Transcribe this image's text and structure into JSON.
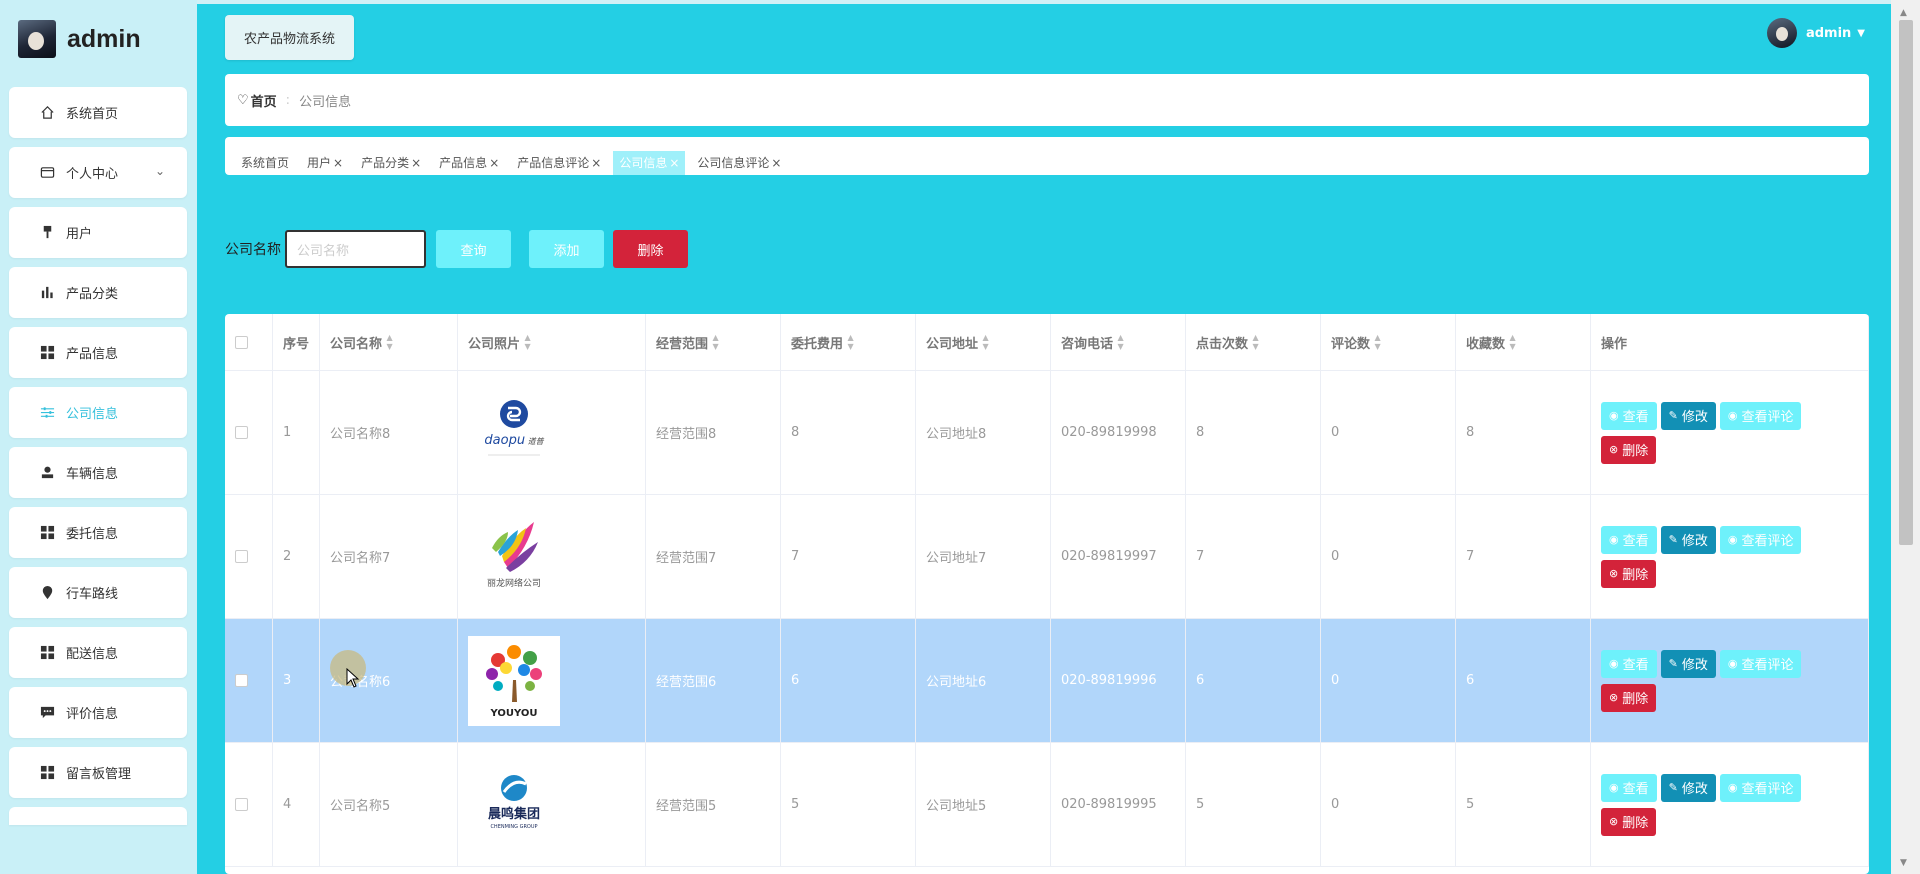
{
  "sidebar": {
    "brand": "admin",
    "items": [
      {
        "label": "系统首页",
        "icon": "home-icon"
      },
      {
        "label": "个人中心",
        "icon": "wallet-icon",
        "expandable": true
      },
      {
        "label": "用户",
        "icon": "user-pin-icon"
      },
      {
        "label": "产品分类",
        "icon": "bar-chart-icon"
      },
      {
        "label": "产品信息",
        "icon": "grid-icon"
      },
      {
        "label": "公司信息",
        "icon": "sliders-icon",
        "active": true
      },
      {
        "label": "车辆信息",
        "icon": "person-icon"
      },
      {
        "label": "委托信息",
        "icon": "grid-icon"
      },
      {
        "label": "行车路线",
        "icon": "location-icon"
      },
      {
        "label": "配送信息",
        "icon": "grid-icon"
      },
      {
        "label": "评价信息",
        "icon": "comment-icon"
      },
      {
        "label": "留言板管理",
        "icon": "grid-icon"
      }
    ]
  },
  "header": {
    "system_title": "农产品物流系统",
    "username": "admin"
  },
  "breadcrumb": {
    "home": "首页",
    "current": "公司信息"
  },
  "tabs": [
    {
      "label": "系统首页",
      "closable": false
    },
    {
      "label": "用户",
      "closable": true
    },
    {
      "label": "产品分类",
      "closable": true
    },
    {
      "label": "产品信息",
      "closable": true
    },
    {
      "label": "产品信息评论",
      "closable": true
    },
    {
      "label": "公司信息",
      "closable": true,
      "active": true
    },
    {
      "label": "公司信息评论",
      "closable": true
    }
  ],
  "search": {
    "label": "公司名称",
    "placeholder": "公司名称",
    "query_label": "查询",
    "add_label": "添加",
    "delete_label": "删除"
  },
  "table": {
    "headers": [
      "序号",
      "公司名称",
      "公司照片",
      "经营范围",
      "委托费用",
      "公司地址",
      "咨询电话",
      "点击次数",
      "评论数",
      "收藏数",
      "操作"
    ],
    "rows": [
      {
        "index": "1",
        "name": "公司名称8",
        "logo": "daopu",
        "scope": "经营范围8",
        "fee": "8",
        "address": "公司地址8",
        "phone": "020-89819998",
        "clicks": "8",
        "comments": "0",
        "favorites": "8",
        "selected": false
      },
      {
        "index": "2",
        "name": "公司名称7",
        "logo": "feathers",
        "scope": "经营范围7",
        "fee": "7",
        "address": "公司地址7",
        "phone": "020-89819997",
        "clicks": "7",
        "comments": "0",
        "favorites": "7",
        "selected": false
      },
      {
        "index": "3",
        "name": "公司名称6",
        "logo": "youyou",
        "scope": "经营范围6",
        "fee": "6",
        "address": "公司地址6",
        "phone": "020-89819996",
        "clicks": "6",
        "comments": "0",
        "favorites": "6",
        "selected": true
      },
      {
        "index": "4",
        "name": "公司名称5",
        "logo": "chenming",
        "scope": "经营范围5",
        "fee": "5",
        "address": "公司地址5",
        "phone": "020-89819995",
        "clicks": "5",
        "comments": "0",
        "favorites": "5",
        "selected": false
      }
    ],
    "actions": {
      "view": "查看",
      "edit": "修改",
      "view_comments": "查看评论",
      "delete": "删除"
    },
    "logo_text": {
      "daopu": "daopu",
      "daopu_cn": "道普",
      "feathers": "丽龙网络公司",
      "youyou": "YOUYOU",
      "chenming": "晨鸣集团",
      "chenming_en": "CHENMING GROUP"
    }
  },
  "colors": {
    "main_bg": "#24cfe4",
    "sidebar_bg": "#c9f0f7",
    "accent": "#35c0dc",
    "danger": "#d3233a",
    "edit": "#1290b5",
    "light_btn": "#6ef1fb",
    "selected_row": "#b1d6fa"
  }
}
